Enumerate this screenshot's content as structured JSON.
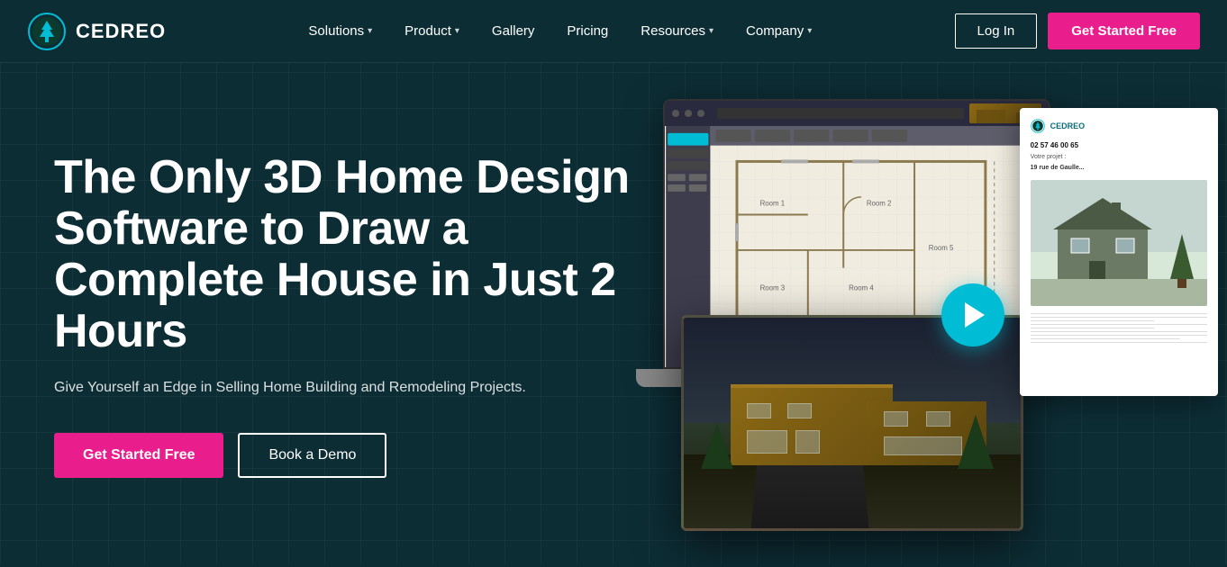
{
  "brand": {
    "name": "CEDREO",
    "logo_alt": "Cedreo logo"
  },
  "nav": {
    "links": [
      {
        "label": "Solutions",
        "has_dropdown": true
      },
      {
        "label": "Product",
        "has_dropdown": true
      },
      {
        "label": "Gallery",
        "has_dropdown": false
      },
      {
        "label": "Pricing",
        "has_dropdown": false
      },
      {
        "label": "Resources",
        "has_dropdown": true
      },
      {
        "label": "Company",
        "has_dropdown": true
      }
    ],
    "login_label": "Log In",
    "cta_label": "Get Started Free"
  },
  "hero": {
    "title": "The Only 3D Home Design Software to Draw a Complete House in Just 2 Hours",
    "subtitle": "Give Yourself an Edge in Selling Home Building and Remodeling Projects.",
    "cta_primary": "Get Started Free",
    "cta_secondary": "Book a Demo"
  }
}
